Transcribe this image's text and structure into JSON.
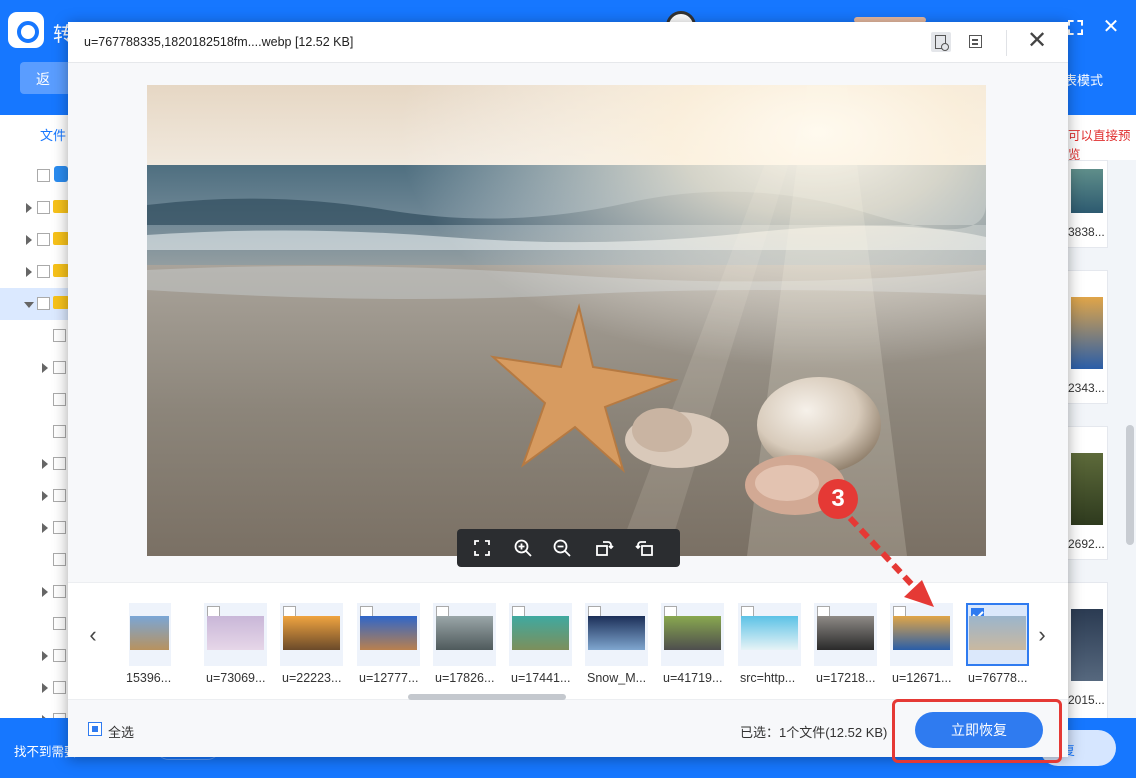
{
  "app": {
    "title_partial": "转",
    "back_label": "返",
    "list_mode_partial": "表模式",
    "file_tab_partial": "文件",
    "notice_partial": "可以直接预览",
    "cant_find_partial": "找不到需要",
    "bottom_btn_partial": "复",
    "right_cards": [
      {
        "label": "3838..."
      },
      {
        "label": "2343..."
      },
      {
        "label": "2692..."
      },
      {
        "label": "2015..."
      }
    ]
  },
  "modal": {
    "title": "u=767788335,1820182518fm....webp [12.52 KB]",
    "thumbnails": [
      {
        "label": "15396...",
        "checked": false,
        "partial": true,
        "color_a": "#7aa6d6",
        "color_b": "#b8925e"
      },
      {
        "label": "u=73069...",
        "checked": false,
        "color_a": "#c9b7d8",
        "color_b": "#e6d6e8"
      },
      {
        "label": "u=22223...",
        "checked": false,
        "color_a": "#f0a440",
        "color_b": "#6b4a2a"
      },
      {
        "label": "u=12777...",
        "checked": false,
        "color_a": "#2f66c9",
        "color_b": "#b9804e"
      },
      {
        "label": "u=17826...",
        "checked": false,
        "color_a": "#9aa6a8",
        "color_b": "#4f5a5c"
      },
      {
        "label": "u=17441...",
        "checked": false,
        "color_a": "#3fa9a0",
        "color_b": "#7d8f5b"
      },
      {
        "label": "Snow_M...",
        "checked": false,
        "color_a": "#1c2f58",
        "color_b": "#7fa6cf"
      },
      {
        "label": "u=41719...",
        "checked": false,
        "color_a": "#89a84f",
        "color_b": "#4e4e4e"
      },
      {
        "label": "src=http...",
        "checked": false,
        "color_a": "#5cc2e6",
        "color_b": "#e6f3f6"
      },
      {
        "label": "u=17218...",
        "checked": false,
        "color_a": "#8e8a86",
        "color_b": "#2a2a2a"
      },
      {
        "label": "u=12671...",
        "checked": false,
        "color_a": "#e0a548",
        "color_b": "#2a5ea8"
      },
      {
        "label": "u=76778...",
        "checked": true,
        "selected": true,
        "color_a": "#9bb5cc",
        "color_b": "#c9b8a0"
      }
    ],
    "select_all_label": "全选",
    "selected_status": "已选：1个文件(12.52 KB)",
    "recover_button": "立即恢复"
  },
  "annotation": {
    "step_number": "3",
    "color": "#e53935"
  }
}
